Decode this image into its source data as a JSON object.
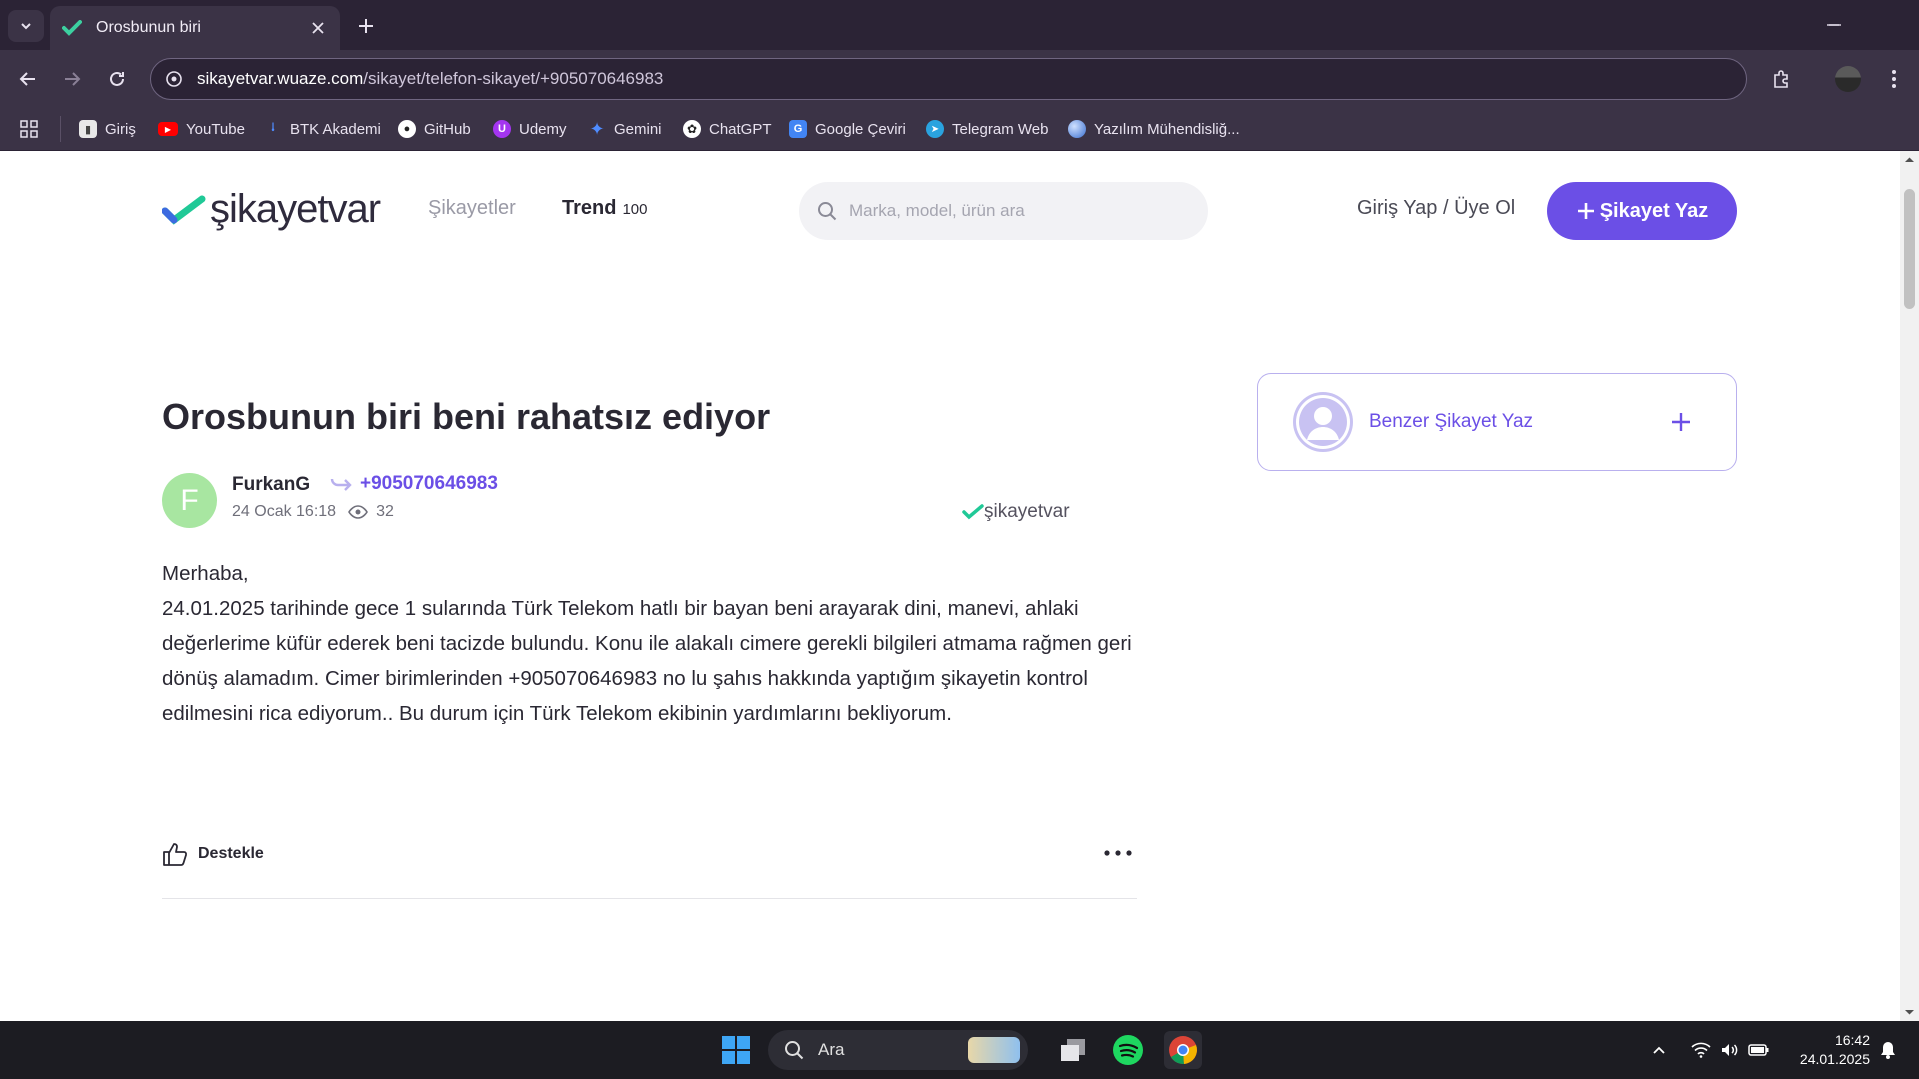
{
  "browser": {
    "tab_title": "Orosbunun biri",
    "url_host": "sikayetvar.wuaze.com",
    "url_path": "/sikayet/telefon-sikayet/+905070646983",
    "bookmarks": [
      {
        "label": "Giriş",
        "color": "#e8e8e8"
      },
      {
        "label": "YouTube",
        "color": "#ff0000"
      },
      {
        "label": "BTK Akademi",
        "color": "#2b6cff"
      },
      {
        "label": "GitHub",
        "color": "#ffffff"
      },
      {
        "label": "Udemy",
        "color": "#a435f0"
      },
      {
        "label": "Gemini",
        "color": "#4f8cff"
      },
      {
        "label": "ChatGPT",
        "color": "#ffffff"
      },
      {
        "label": "Google Çeviri",
        "color": "#4285f4"
      },
      {
        "label": "Telegram Web",
        "color": "#2aa3df"
      },
      {
        "label": "Yazılım Mühendisliğ...",
        "color": "#5a8de0"
      }
    ]
  },
  "site": {
    "logo_text": "şikayetvar",
    "nav": {
      "complaints": "Şikayetler",
      "trend": "Trend",
      "trend_count": "100"
    },
    "search_placeholder": "Marka, model, ürün ara",
    "login": "Giriş Yap / Üye Ol",
    "cta": "Şikayet Yaz",
    "accent": "#6b4fe6"
  },
  "complaint": {
    "title": "Orosbunun biri beni rahatsız ediyor",
    "avatar_letter": "F",
    "author": "FurkanG",
    "target": "+905070646983",
    "date": "24 Ocak 16:18",
    "views": "32",
    "watermark": "şikayetvar",
    "body_greeting": "Merhaba,",
    "body_text": "24.01.2025 tarihinde gece 1 sularında Türk Telekom hatlı bir bayan beni arayarak dini, manevi, ahlaki değerlerime küfür ederek beni tacizde bulundu. Konu ile alakalı cimere gerekli bilgileri atmama rağmen geri dönüş alamadım. Cimer birimlerinden +905070646983 no lu şahıs hakkında yaptığım şikayetin kontrol edilmesini rica ediyorum.. Bu durum için Türk Telekom ekibinin yardımlarını bekliyorum.",
    "support_label": "Destekle"
  },
  "sidebar": {
    "similar_label": "Benzer Şikayet Yaz"
  },
  "taskbar": {
    "search_label": "Ara",
    "time": "16:42",
    "date": "24.01.2025"
  }
}
